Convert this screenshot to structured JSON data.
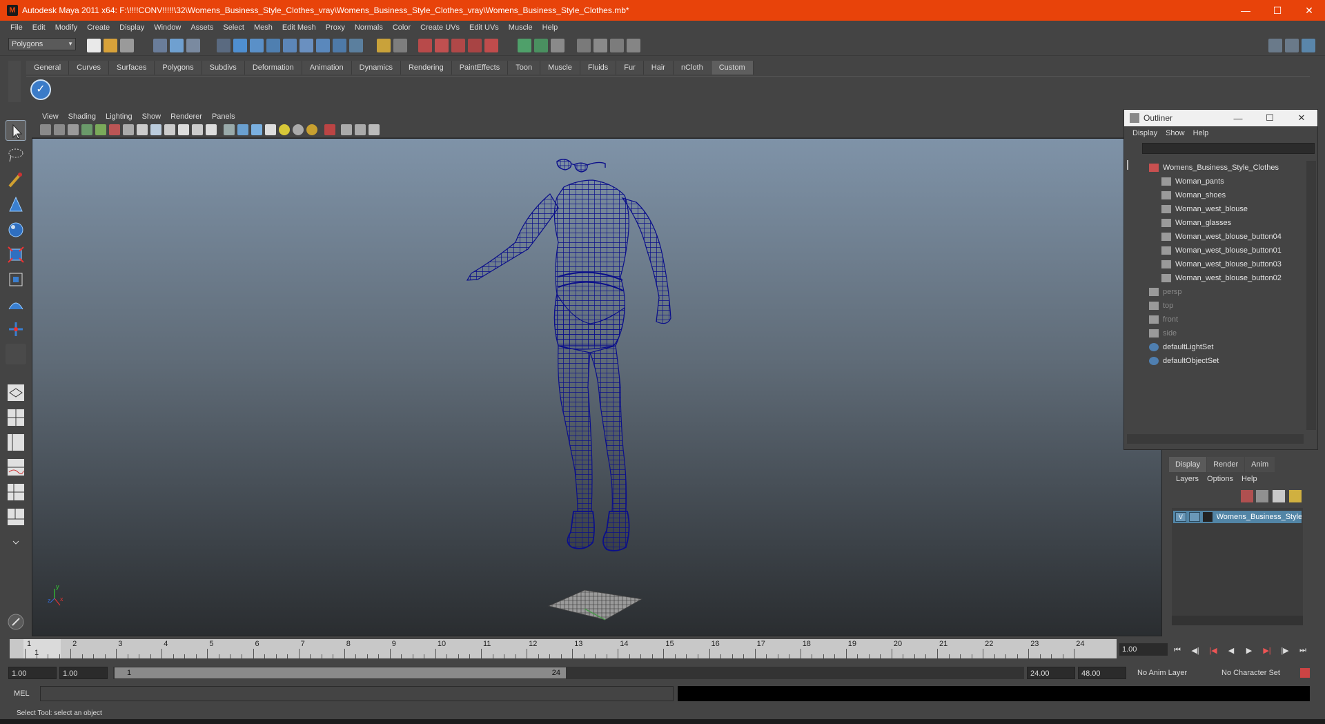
{
  "title": {
    "text": "Autodesk Maya 2011 x64: F:\\!!!!CONV!!!!!\\32\\Womens_Business_Style_Clothes_vray\\Womens_Business_Style_Clothes_vray\\Womens_Business_Style_Clothes.mb*"
  },
  "menubar": [
    "File",
    "Edit",
    "Modify",
    "Create",
    "Display",
    "Window",
    "Assets",
    "Select",
    "Mesh",
    "Edit Mesh",
    "Proxy",
    "Normals",
    "Color",
    "Create UVs",
    "Edit UVs",
    "Muscle",
    "Help"
  ],
  "statusline": {
    "mode_selector": "Polygons"
  },
  "shelf": {
    "tabs": [
      "General",
      "Curves",
      "Surfaces",
      "Polygons",
      "Subdivs",
      "Deformation",
      "Animation",
      "Dynamics",
      "Rendering",
      "PaintEffects",
      "Toon",
      "Muscle",
      "Fluids",
      "Fur",
      "Hair",
      "nCloth",
      "Custom"
    ],
    "active_tab": "Custom"
  },
  "viewport": {
    "menu": [
      "View",
      "Shading",
      "Lighting",
      "Show",
      "Renderer",
      "Panels"
    ],
    "axis_labels": {
      "x": "x",
      "y": "y",
      "z": "z"
    },
    "wireframe_color": "#0b0f8a"
  },
  "outliner": {
    "title": "Outliner",
    "menu": [
      "Display",
      "Show",
      "Help"
    ],
    "items": [
      {
        "label": "Womens_Business_Style_Clothes",
        "type": "group",
        "dim": false
      },
      {
        "label": "Woman_pants",
        "type": "mesh",
        "dim": false
      },
      {
        "label": "Woman_shoes",
        "type": "mesh",
        "dim": false
      },
      {
        "label": "Woman_west_blouse",
        "type": "mesh",
        "dim": false
      },
      {
        "label": "Woman_glasses",
        "type": "mesh",
        "dim": false
      },
      {
        "label": "Woman_west_blouse_button04",
        "type": "mesh",
        "dim": false
      },
      {
        "label": "Woman_west_blouse_button01",
        "type": "mesh",
        "dim": false
      },
      {
        "label": "Woman_west_blouse_button03",
        "type": "mesh",
        "dim": false
      },
      {
        "label": "Woman_west_blouse_button02",
        "type": "mesh",
        "dim": false
      },
      {
        "label": "persp",
        "type": "camera",
        "dim": true
      },
      {
        "label": "top",
        "type": "camera",
        "dim": true
      },
      {
        "label": "front",
        "type": "camera",
        "dim": true
      },
      {
        "label": "side",
        "type": "camera",
        "dim": true
      },
      {
        "label": "defaultLightSet",
        "type": "set",
        "dim": false
      },
      {
        "label": "defaultObjectSet",
        "type": "set",
        "dim": false
      }
    ]
  },
  "layer_editor": {
    "tabs": [
      "Display",
      "Render",
      "Anim"
    ],
    "active_tab": "Display",
    "menu": [
      "Layers",
      "Options",
      "Help"
    ],
    "layers": [
      {
        "visible": "V",
        "name": "Womens_Business_Style"
      }
    ]
  },
  "timeslider": {
    "ticks": [
      "1",
      "2",
      "3",
      "4",
      "5",
      "6",
      "7",
      "8",
      "9",
      "10",
      "11",
      "12",
      "13",
      "14",
      "15",
      "16",
      "17",
      "18",
      "19",
      "20",
      "21",
      "22",
      "23",
      "24"
    ],
    "current_frame": "1",
    "current_time_field": "1.00"
  },
  "range": {
    "start_time": "1.00",
    "playback_start": "1.00",
    "bar_start": "1",
    "bar_end": "24",
    "playback_end": "24.00",
    "end_time": "48.00",
    "anim_layer": "No Anim Layer",
    "character_set": "No Character Set"
  },
  "commandline": {
    "label": "MEL"
  },
  "helpline": {
    "text": "Select Tool: select an object"
  },
  "colors": {
    "title_bar": "#e8430a",
    "ui_bg": "#444444",
    "selection": "#5285a6"
  }
}
